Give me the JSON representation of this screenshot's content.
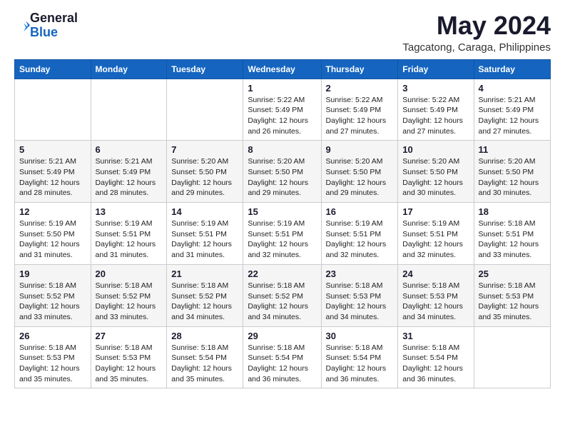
{
  "logo": {
    "general": "General",
    "blue": "Blue"
  },
  "title": "May 2024",
  "subtitle": "Tagcatong, Caraga, Philippines",
  "days_of_week": [
    "Sunday",
    "Monday",
    "Tuesday",
    "Wednesday",
    "Thursday",
    "Friday",
    "Saturday"
  ],
  "weeks": [
    [
      {
        "day": "",
        "info": ""
      },
      {
        "day": "",
        "info": ""
      },
      {
        "day": "",
        "info": ""
      },
      {
        "day": "1",
        "info": "Sunrise: 5:22 AM\nSunset: 5:49 PM\nDaylight: 12 hours and 26 minutes."
      },
      {
        "day": "2",
        "info": "Sunrise: 5:22 AM\nSunset: 5:49 PM\nDaylight: 12 hours and 27 minutes."
      },
      {
        "day": "3",
        "info": "Sunrise: 5:22 AM\nSunset: 5:49 PM\nDaylight: 12 hours and 27 minutes."
      },
      {
        "day": "4",
        "info": "Sunrise: 5:21 AM\nSunset: 5:49 PM\nDaylight: 12 hours and 27 minutes."
      }
    ],
    [
      {
        "day": "5",
        "info": "Sunrise: 5:21 AM\nSunset: 5:49 PM\nDaylight: 12 hours and 28 minutes."
      },
      {
        "day": "6",
        "info": "Sunrise: 5:21 AM\nSunset: 5:49 PM\nDaylight: 12 hours and 28 minutes."
      },
      {
        "day": "7",
        "info": "Sunrise: 5:20 AM\nSunset: 5:50 PM\nDaylight: 12 hours and 29 minutes."
      },
      {
        "day": "8",
        "info": "Sunrise: 5:20 AM\nSunset: 5:50 PM\nDaylight: 12 hours and 29 minutes."
      },
      {
        "day": "9",
        "info": "Sunrise: 5:20 AM\nSunset: 5:50 PM\nDaylight: 12 hours and 29 minutes."
      },
      {
        "day": "10",
        "info": "Sunrise: 5:20 AM\nSunset: 5:50 PM\nDaylight: 12 hours and 30 minutes."
      },
      {
        "day": "11",
        "info": "Sunrise: 5:20 AM\nSunset: 5:50 PM\nDaylight: 12 hours and 30 minutes."
      }
    ],
    [
      {
        "day": "12",
        "info": "Sunrise: 5:19 AM\nSunset: 5:50 PM\nDaylight: 12 hours and 31 minutes."
      },
      {
        "day": "13",
        "info": "Sunrise: 5:19 AM\nSunset: 5:51 PM\nDaylight: 12 hours and 31 minutes."
      },
      {
        "day": "14",
        "info": "Sunrise: 5:19 AM\nSunset: 5:51 PM\nDaylight: 12 hours and 31 minutes."
      },
      {
        "day": "15",
        "info": "Sunrise: 5:19 AM\nSunset: 5:51 PM\nDaylight: 12 hours and 32 minutes."
      },
      {
        "day": "16",
        "info": "Sunrise: 5:19 AM\nSunset: 5:51 PM\nDaylight: 12 hours and 32 minutes."
      },
      {
        "day": "17",
        "info": "Sunrise: 5:19 AM\nSunset: 5:51 PM\nDaylight: 12 hours and 32 minutes."
      },
      {
        "day": "18",
        "info": "Sunrise: 5:18 AM\nSunset: 5:51 PM\nDaylight: 12 hours and 33 minutes."
      }
    ],
    [
      {
        "day": "19",
        "info": "Sunrise: 5:18 AM\nSunset: 5:52 PM\nDaylight: 12 hours and 33 minutes."
      },
      {
        "day": "20",
        "info": "Sunrise: 5:18 AM\nSunset: 5:52 PM\nDaylight: 12 hours and 33 minutes."
      },
      {
        "day": "21",
        "info": "Sunrise: 5:18 AM\nSunset: 5:52 PM\nDaylight: 12 hours and 34 minutes."
      },
      {
        "day": "22",
        "info": "Sunrise: 5:18 AM\nSunset: 5:52 PM\nDaylight: 12 hours and 34 minutes."
      },
      {
        "day": "23",
        "info": "Sunrise: 5:18 AM\nSunset: 5:53 PM\nDaylight: 12 hours and 34 minutes."
      },
      {
        "day": "24",
        "info": "Sunrise: 5:18 AM\nSunset: 5:53 PM\nDaylight: 12 hours and 34 minutes."
      },
      {
        "day": "25",
        "info": "Sunrise: 5:18 AM\nSunset: 5:53 PM\nDaylight: 12 hours and 35 minutes."
      }
    ],
    [
      {
        "day": "26",
        "info": "Sunrise: 5:18 AM\nSunset: 5:53 PM\nDaylight: 12 hours and 35 minutes."
      },
      {
        "day": "27",
        "info": "Sunrise: 5:18 AM\nSunset: 5:53 PM\nDaylight: 12 hours and 35 minutes."
      },
      {
        "day": "28",
        "info": "Sunrise: 5:18 AM\nSunset: 5:54 PM\nDaylight: 12 hours and 35 minutes."
      },
      {
        "day": "29",
        "info": "Sunrise: 5:18 AM\nSunset: 5:54 PM\nDaylight: 12 hours and 36 minutes."
      },
      {
        "day": "30",
        "info": "Sunrise: 5:18 AM\nSunset: 5:54 PM\nDaylight: 12 hours and 36 minutes."
      },
      {
        "day": "31",
        "info": "Sunrise: 5:18 AM\nSunset: 5:54 PM\nDaylight: 12 hours and 36 minutes."
      },
      {
        "day": "",
        "info": ""
      }
    ]
  ]
}
